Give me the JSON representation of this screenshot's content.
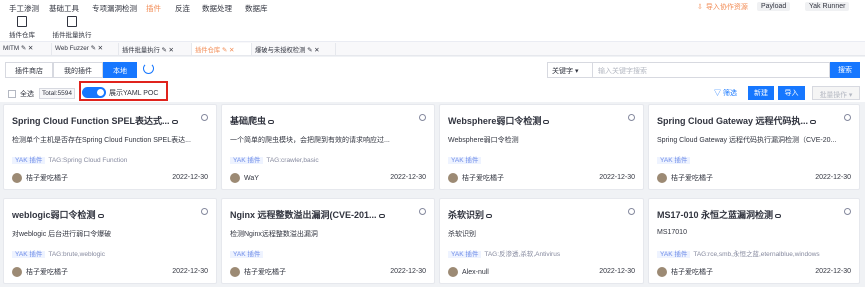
{
  "top_menu": {
    "items": [
      "手工渗测",
      "基础工具",
      "专项漏洞检测",
      "插件",
      "反连",
      "数据处理",
      "数据库"
    ],
    "active_index": 3,
    "import_resources": "导入协作资源",
    "payload": "Payload",
    "runner": "Yak Runner"
  },
  "sub_tools": [
    "插件仓库",
    "插件批量执行"
  ],
  "tabs": [
    {
      "label": "MITM"
    },
    {
      "label": "Web Fuzzer"
    },
    {
      "label": "插件批量执行"
    },
    {
      "label": "插件仓库",
      "active": true
    },
    {
      "label": "爆破与未授权检测"
    }
  ],
  "store": {
    "segments": [
      "插件商店",
      "我的插件",
      "本地"
    ],
    "active_segment": 2,
    "keyword_select": "关键字",
    "search_placeholder": "输入关键字搜索",
    "search_button": "搜索"
  },
  "filter": {
    "select_all": "全选",
    "total": "Total:5594",
    "show_yaml": "展示YAML POC",
    "filter_label": "筛选",
    "new_button": "新建",
    "import_button": "导入",
    "batch_button": "批量操作"
  },
  "cards": [
    {
      "title": "Spring Cloud Function SPEL表达式...",
      "desc": "检测单个主机是否存在Spring Cloud Function SPEL表达...",
      "yak": "YAK 插件",
      "tag": "TAG:Spring Cloud Function",
      "author": "桔子爱吃橘子",
      "date": "2022-12-30"
    },
    {
      "title": "基础爬虫",
      "desc": "一个简单的爬虫模块，会把爬到有效的请求响应过...",
      "yak": "YAK 插件",
      "tag": "TAG:crawler,basic",
      "author": "WaY",
      "date": "2022-12-30"
    },
    {
      "title": "Websphere弱口令检测",
      "desc": "Websphere弱口令检测",
      "yak": "YAK 插件",
      "tag": "",
      "author": "桔子爱吃橘子",
      "date": "2022-12-30"
    },
    {
      "title": "Spring Cloud Gateway 远程代码执...",
      "desc": "Spring Cloud Gateway 远程代码执行漏洞检测（CVE-20...",
      "yak": "YAK 插件",
      "tag": "",
      "author": "桔子爱吃橘子",
      "date": "2022-12-30"
    },
    {
      "title": "weblogic弱口令检测",
      "desc": "对weblogic 后台进行弱口令爆破",
      "yak": "YAK 插件",
      "tag": "TAG:brute,weblogic",
      "author": "桔子爱吃橘子",
      "date": "2022-12-30"
    },
    {
      "title": "Nginx 远程整数溢出漏洞(CVE-201...",
      "desc": "检测Nginx远程整数溢出漏洞",
      "yak": "YAK 插件",
      "tag": "",
      "author": "桔子爱吃橘子",
      "date": "2022-12-30"
    },
    {
      "title": "杀软识别",
      "desc": "杀软识别",
      "yak": "YAK 插件",
      "tag": "TAG:反渗透,杀软,Antivirus",
      "author": "Alex-null",
      "date": "2022-12-30"
    },
    {
      "title": "MS17-010 永恒之蓝漏洞检测",
      "desc": "MS17010",
      "yak": "YAK 插件",
      "tag": "TAG:rce,smb,永恒之蓝,eternalblue,windows",
      "author": "桔子爱吃橘子",
      "date": "2022-12-30"
    }
  ],
  "colors": {
    "accent": "#1677ff",
    "active_menu": "#f28b54",
    "highlight_box": "#e0231c"
  }
}
